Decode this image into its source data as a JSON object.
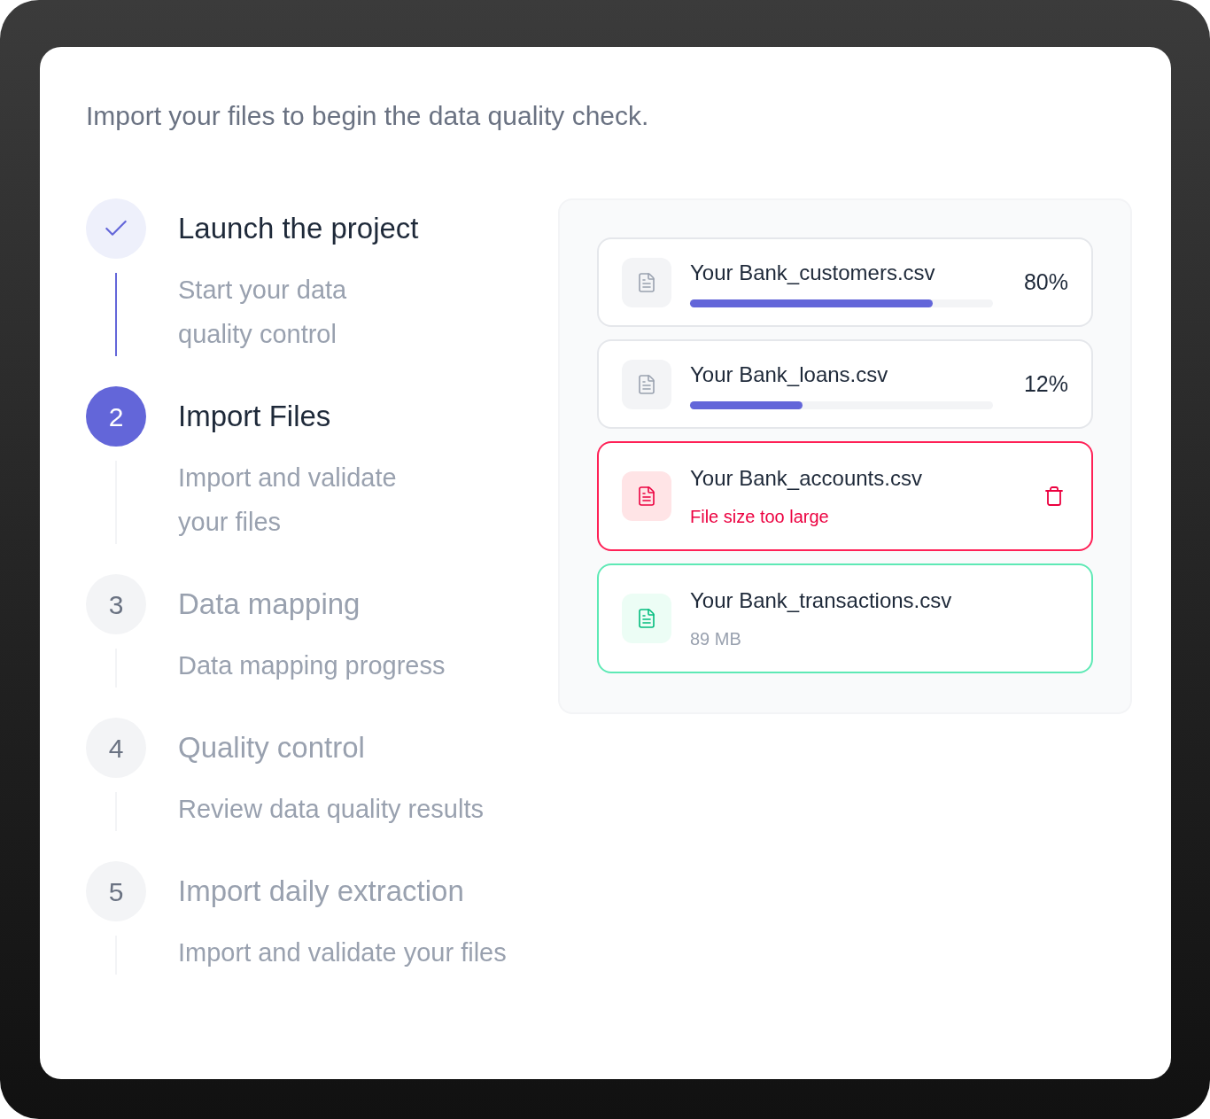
{
  "intro": "Import your files to begin the data quality check.",
  "steps": [
    {
      "kind": "done",
      "title": "Launch the project",
      "subtitle": "Start your data quality control"
    },
    {
      "marker": "2",
      "kind": "current",
      "title": "Import Files",
      "subtitle": "Import and validate your files"
    },
    {
      "marker": "3",
      "kind": "upcoming",
      "title": "Data mapping",
      "subtitle": "Data mapping progress"
    },
    {
      "marker": "4",
      "kind": "upcoming",
      "title": "Quality control",
      "subtitle": "Review data quality results"
    },
    {
      "marker": "5",
      "kind": "upcoming",
      "title": "Import daily extraction",
      "subtitle": "Import and validate your files"
    }
  ],
  "files": [
    {
      "kind": "progress",
      "name": "Your Bank_customers.csv",
      "level": 0.8,
      "percent": "80%"
    },
    {
      "kind": "progress",
      "name": "Your Bank_loans.csv",
      "level": 0.37,
      "percent": "12%"
    },
    {
      "kind": "error",
      "name": "Your Bank_accounts.csv",
      "message": "File size too large"
    },
    {
      "kind": "done",
      "name": "Your Bank_transactions.csv",
      "size": "89 MB"
    }
  ]
}
